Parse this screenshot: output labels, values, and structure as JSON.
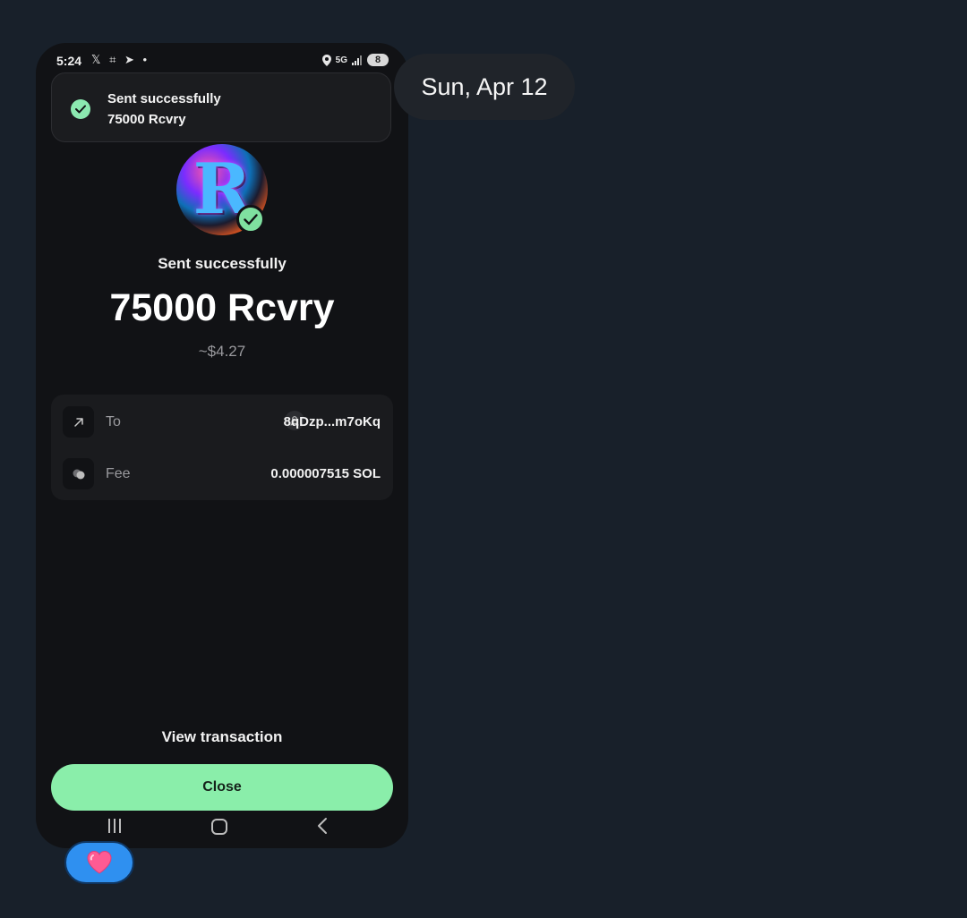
{
  "status_bar": {
    "time": "5:24",
    "left_icons": "𝕏 ⌗ ➤ •",
    "network": "5G",
    "battery": "8"
  },
  "toast": {
    "title": "Sent successfully",
    "amount": "75000 Rcvry",
    "icon": "check-circle-icon"
  },
  "token": {
    "letter": "R",
    "verified_icon": "check-circle-icon"
  },
  "transaction": {
    "status": "Sent successfully",
    "amount": "75000 Rcvry",
    "fiat_estimate": "~$4.27"
  },
  "details": {
    "to_label": "To",
    "to_value": "8qDzp...m7oKq",
    "fee_label": "Fee",
    "fee_value": "0.000007515 SOL"
  },
  "actions": {
    "view_transaction": "View transaction",
    "close": "Close"
  },
  "chat": {
    "date": "Sun, Apr 12",
    "reaction": "💗"
  },
  "colors": {
    "accent_green": "#8aeeaa",
    "phone_bg": "#111215",
    "page_bg": "#18202a",
    "reaction_bg": "#2f90f0"
  }
}
